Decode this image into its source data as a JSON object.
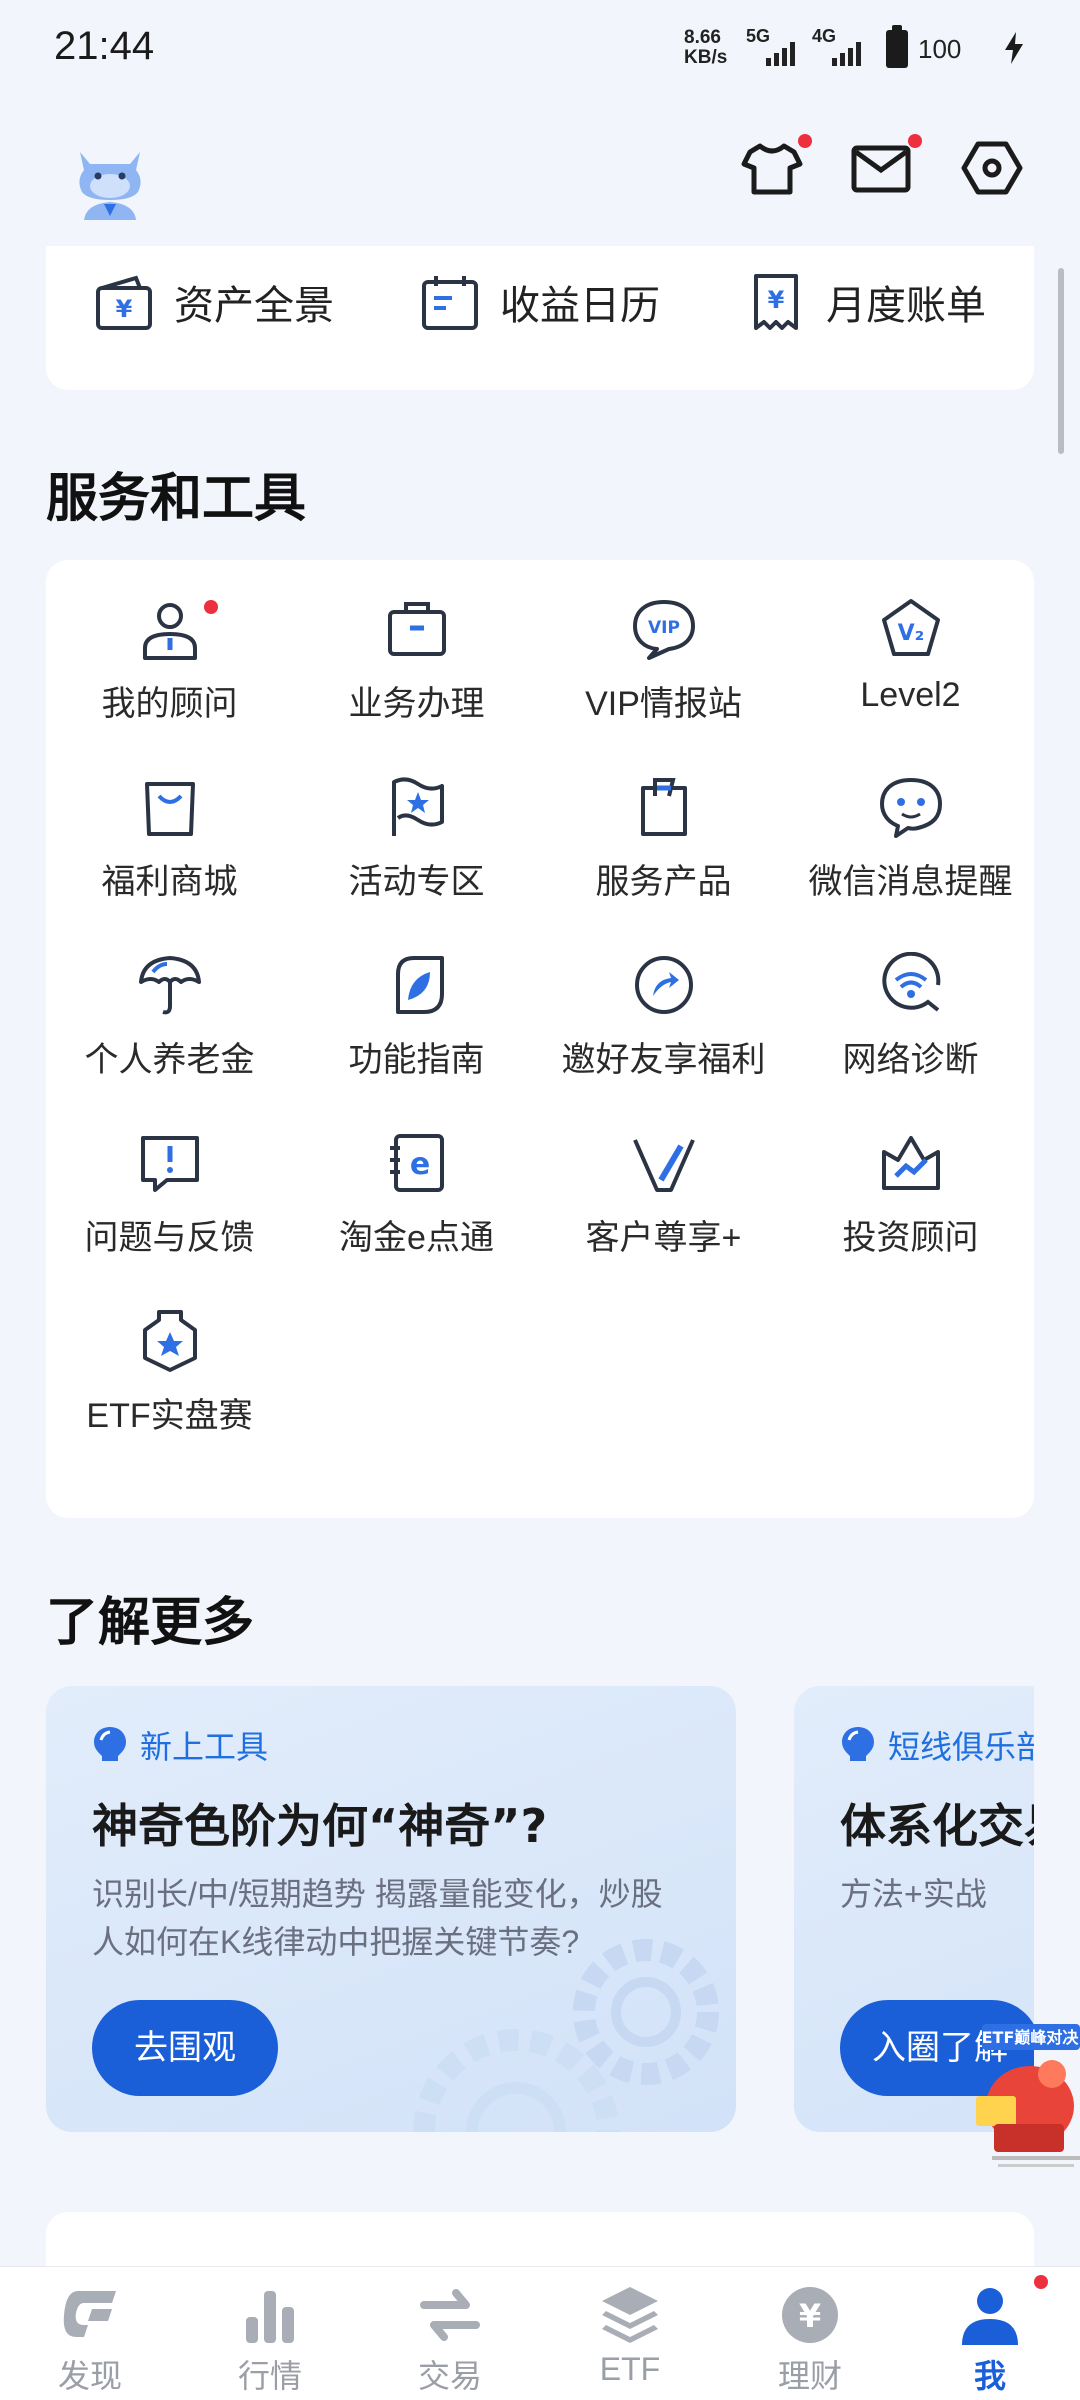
{
  "status_bar": {
    "time": "21:44",
    "net_speed_value": "8.66",
    "net_speed_unit": "KB/s",
    "signal_1": "5G",
    "signal_2": "4G",
    "battery": "100"
  },
  "header": {
    "notifications": {
      "theme_has_dot": true,
      "mail_has_dot": true
    }
  },
  "assets": [
    {
      "label": "资产全景",
      "icon": "wallet-yuan-icon"
    },
    {
      "label": "收益日历",
      "icon": "calendar-icon"
    },
    {
      "label": "月度账单",
      "icon": "bill-yuan-icon"
    }
  ],
  "tools_section": {
    "title": "服务和工具",
    "items": [
      {
        "label": "我的顾问",
        "icon": "advisor-icon",
        "has_dot": true
      },
      {
        "label": "业务办理",
        "icon": "briefcase-icon"
      },
      {
        "label": "VIP情报站",
        "icon": "vip-bubble-icon"
      },
      {
        "label": "Level2",
        "icon": "level2-badge-icon"
      },
      {
        "label": "福利商城",
        "icon": "shopping-bag-icon"
      },
      {
        "label": "活动专区",
        "icon": "flag-star-icon"
      },
      {
        "label": "服务产品",
        "icon": "clipboard-icon"
      },
      {
        "label": "微信消息提醒",
        "icon": "wechat-icon"
      },
      {
        "label": "个人养老金",
        "icon": "umbrella-icon"
      },
      {
        "label": "功能指南",
        "icon": "leaf-icon"
      },
      {
        "label": "邀好友享福利",
        "icon": "share-icon"
      },
      {
        "label": "网络诊断",
        "icon": "wifi-check-icon"
      },
      {
        "label": "问题与反馈",
        "icon": "feedback-icon"
      },
      {
        "label": "淘金e点通",
        "icon": "e-book-icon"
      },
      {
        "label": "客户尊享+",
        "icon": "v-logo-icon"
      },
      {
        "label": "投资顾问",
        "icon": "crown-chart-icon"
      },
      {
        "label": "ETF实盘赛",
        "icon": "medal-icon"
      }
    ]
  },
  "learn_section": {
    "title": "了解更多",
    "cards": [
      {
        "tag": "新上工具",
        "title": "神奇色阶为何“神奇”?",
        "desc": "识别长/中/短期趋势 揭露量能变化，炒股人如何在K线律动中把握关键节奏?",
        "button": "去围观"
      },
      {
        "tag": "短线俱乐部",
        "title": "体系化交易",
        "desc": "方法+实战",
        "button": "入圈了解"
      }
    ],
    "badge_text": "ETF巅峰对决"
  },
  "tabbar": {
    "active": "我",
    "tabs": [
      {
        "label": "发现",
        "icon": "discover-icon"
      },
      {
        "label": "行情",
        "icon": "market-bars-icon"
      },
      {
        "label": "交易",
        "icon": "trade-arrows-icon"
      },
      {
        "label": "ETF",
        "icon": "etf-layers-icon"
      },
      {
        "label": "理财",
        "icon": "wealth-yuan-icon"
      },
      {
        "label": "我",
        "icon": "profile-icon",
        "has_dot": true
      }
    ]
  },
  "colors": {
    "accent": "#1a5fd8",
    "icon_stroke": "#2b3445",
    "icon_accent": "#2f6fe4",
    "dot": "#ee2f3d",
    "background": "#f2f5fb"
  }
}
